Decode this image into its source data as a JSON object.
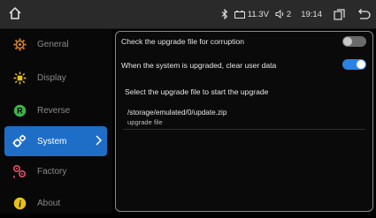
{
  "statusbar": {
    "home_icon": "home-icon",
    "bluetooth_icon": "bluetooth-icon",
    "battery_icon": "battery-icon",
    "voltage": "11.3V",
    "volume_icon": "speaker-icon",
    "volume": "2",
    "time": "19:14",
    "window_icon": "window-icon",
    "back_icon": "back-icon"
  },
  "sidebar": {
    "items": [
      {
        "label": "General",
        "icon": "gear-icon",
        "color": "#d9822b"
      },
      {
        "label": "Display",
        "icon": "sun-icon",
        "color": "#e8c21a"
      },
      {
        "label": "Reverse",
        "icon": "r-circle-icon",
        "color": "#3cb44a"
      },
      {
        "label": "System",
        "icon": "cogs-icon",
        "color": "#ffffff",
        "active": true
      },
      {
        "label": "Factory",
        "icon": "factory-gears-icon",
        "color": "#e2506a"
      },
      {
        "label": "About",
        "icon": "info-icon",
        "color": "#e8c21a"
      }
    ]
  },
  "content": {
    "row1_label": "Check the upgrade file for corruption",
    "row1_toggle": "off",
    "row2_label": "When the system is upgraded, clear user data",
    "row2_toggle": "on",
    "section_label": "Select the upgrade file to start the upgrade",
    "file_path": "/storage/emulated/0/update.zip",
    "file_subtitle": "upgrade file"
  },
  "colors": {
    "accent": "#1e6ec8",
    "toggle_on": "#2a82e4",
    "toggle_off": "#6a6a6a"
  }
}
